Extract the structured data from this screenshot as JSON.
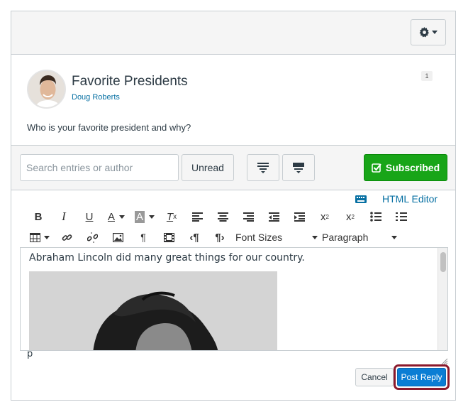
{
  "header": {
    "settings_menu": "gear-icon"
  },
  "topic": {
    "title": "Favorite Presidents",
    "author": "Doug Roberts",
    "unread_count": "1",
    "question": "Who is your favorite president and why?"
  },
  "toolbar": {
    "search_placeholder": "Search entries or author",
    "unread_label": "Unread",
    "subscribed_label": "Subscribed",
    "colors": {
      "subscribed": "#18a518",
      "link": "#0770a3"
    }
  },
  "editor": {
    "html_editor_label": "HTML Editor",
    "font_sizes_label": "Font Sizes",
    "paragraph_label": "Paragraph",
    "content_text": "Abraham Lincoln did many great things for our country.",
    "path_label": "p",
    "row1_icons": [
      "bold-icon",
      "italic-icon",
      "underline-icon",
      "text-color-icon",
      "background-color-icon",
      "clear-formatting-icon",
      "align-left-icon",
      "align-center-icon",
      "align-right-icon",
      "outdent-icon",
      "indent-icon",
      "superscript-icon",
      "subscript-icon",
      "bullet-list-icon",
      "numbered-list-icon"
    ],
    "row2_icons": [
      "table-icon",
      "link-icon",
      "unlink-icon",
      "image-icon",
      "pilcrow-icon",
      "media-icon",
      "ltr-icon",
      "rtl-icon"
    ]
  },
  "actions": {
    "cancel_label": "Cancel",
    "post_label": "Post Reply",
    "colors": {
      "post": "#0b7dd4",
      "highlight": "#8b1a2d"
    }
  }
}
